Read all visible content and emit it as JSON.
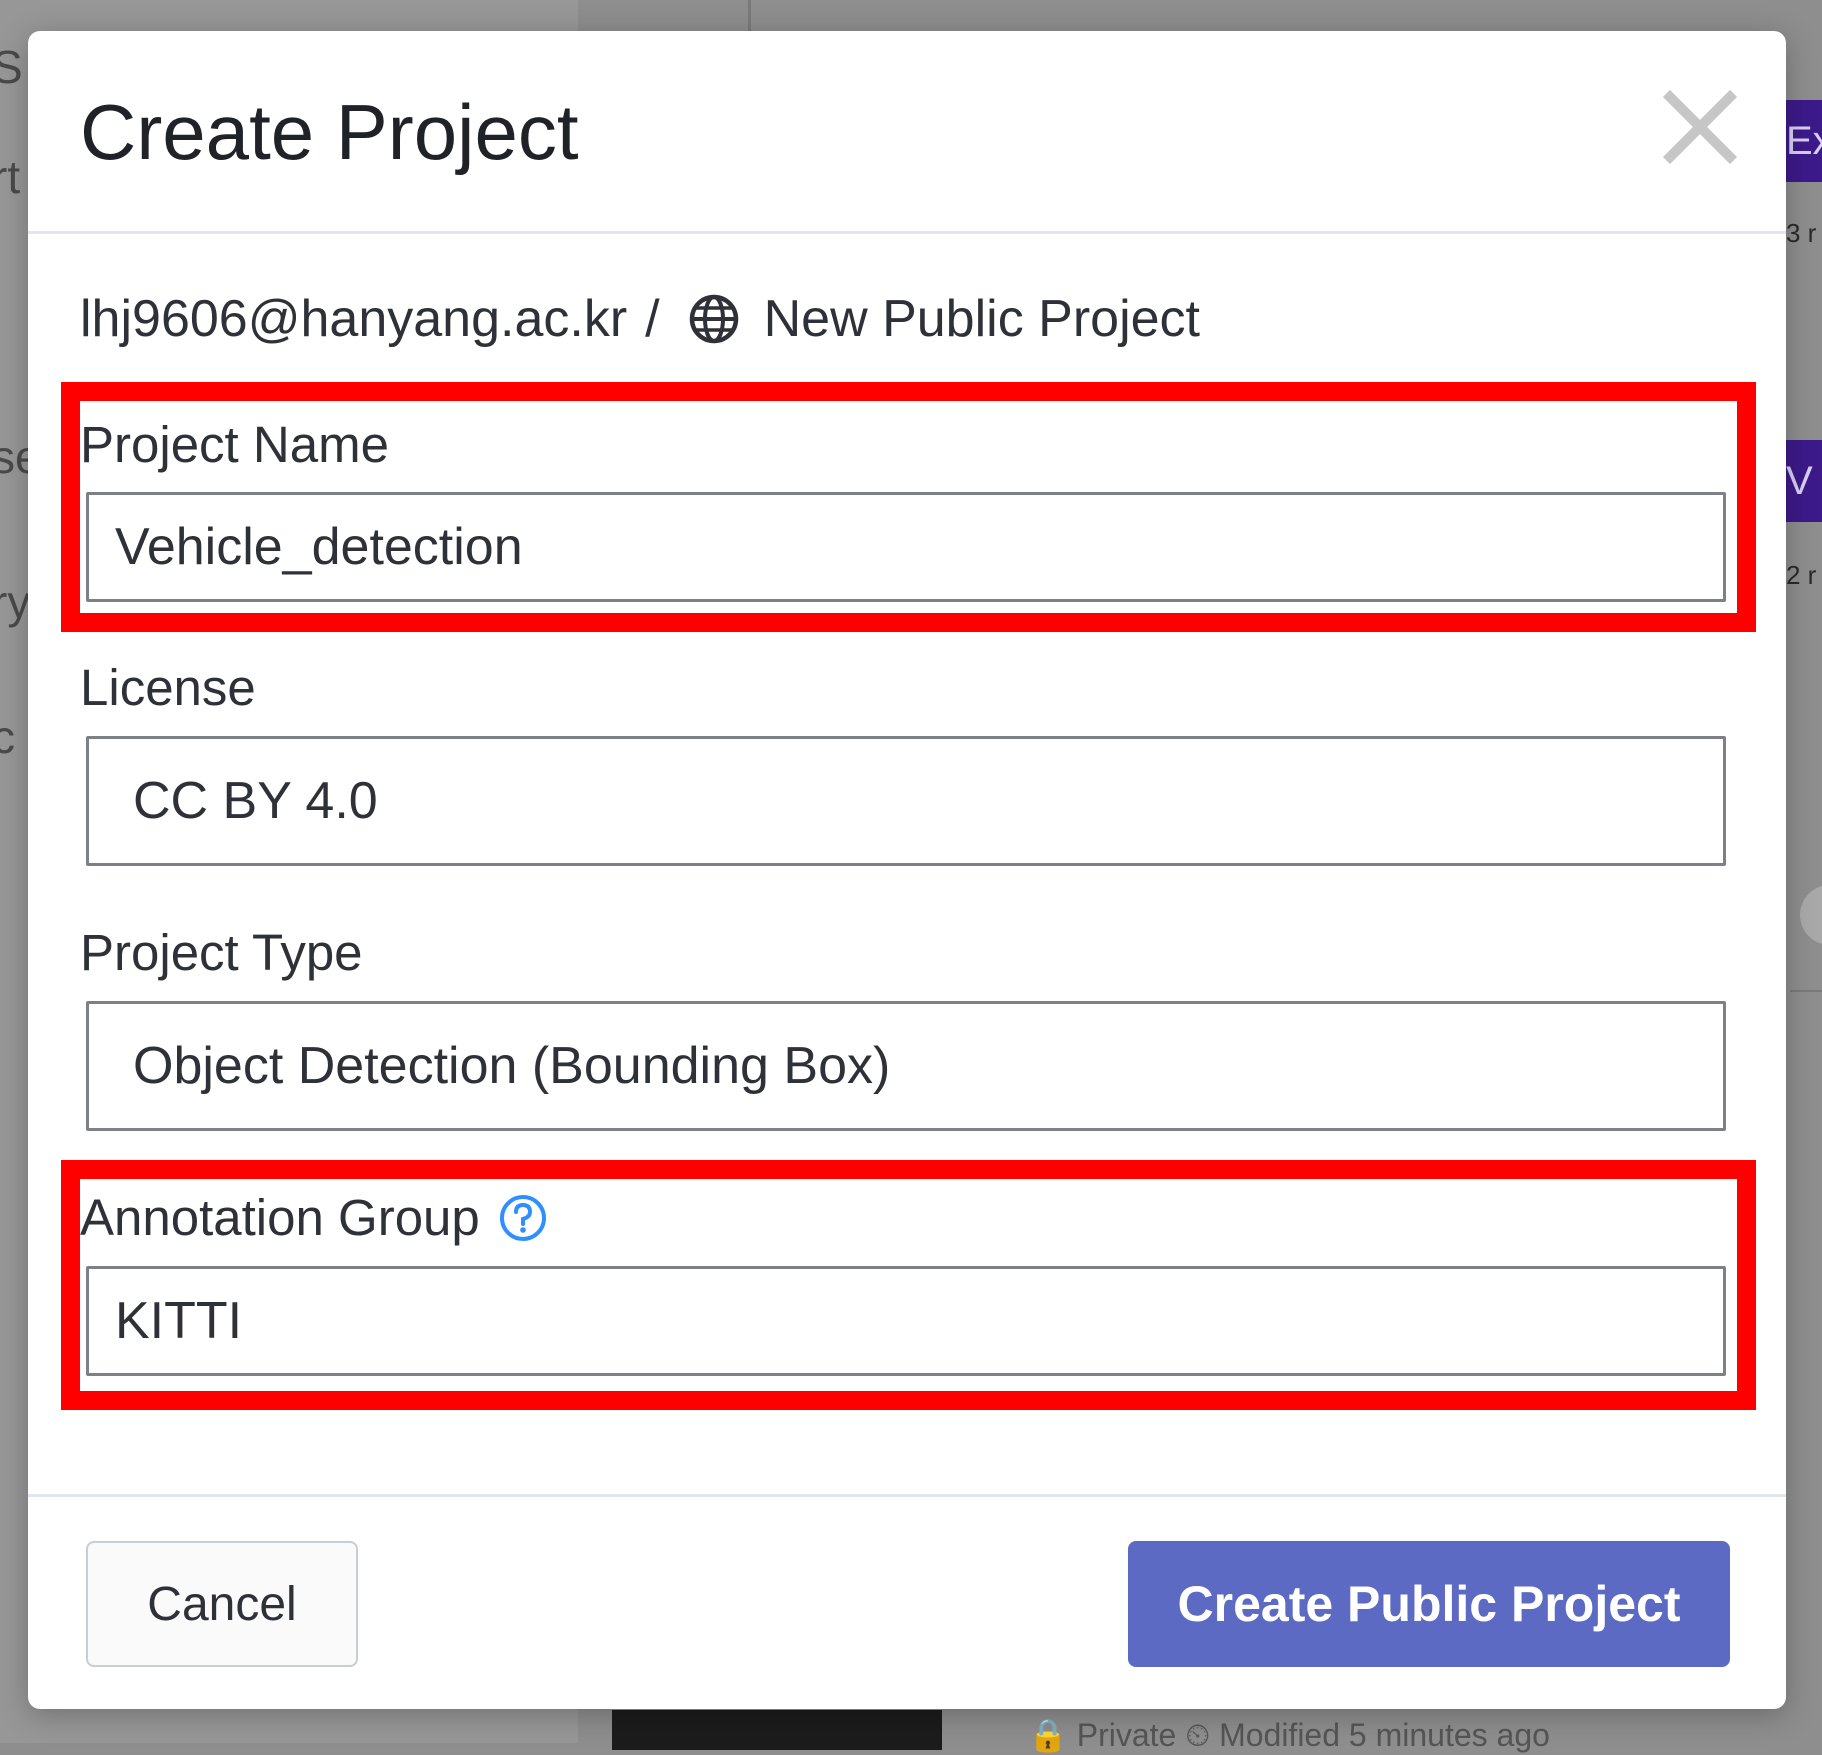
{
  "background": {
    "left_fragments": [
      "S",
      "rt",
      "se",
      "ry",
      "c"
    ],
    "right_badges": [
      "Ex",
      "V"
    ],
    "right_smalls": [
      "3 r",
      "2 r"
    ],
    "footer_text": "🔒 Private    ⏲ Modified 5 minutes ago"
  },
  "modal": {
    "title": "Create Project",
    "close_icon": "close-icon",
    "breadcrumb": {
      "owner": "lhj9606@hanyang.ac.kr",
      "separator": "/",
      "icon": "globe-icon",
      "project": "New Public Project"
    },
    "fields": {
      "project_name": {
        "label": "Project Name",
        "value": "Vehicle_detection"
      },
      "license": {
        "label": "License",
        "value": "CC BY 4.0"
      },
      "project_type": {
        "label": "Project Type",
        "value": "Object Detection (Bounding Box)"
      },
      "annotation_group": {
        "label": "Annotation Group",
        "value": "KITTI",
        "help_icon": "question-circle-icon"
      }
    },
    "footer": {
      "cancel_label": "Cancel",
      "submit_label": "Create Public Project"
    }
  },
  "colors": {
    "primary_button": "#5d6ac4",
    "highlight": "#ff0000",
    "help_icon": "#2f8fff"
  }
}
